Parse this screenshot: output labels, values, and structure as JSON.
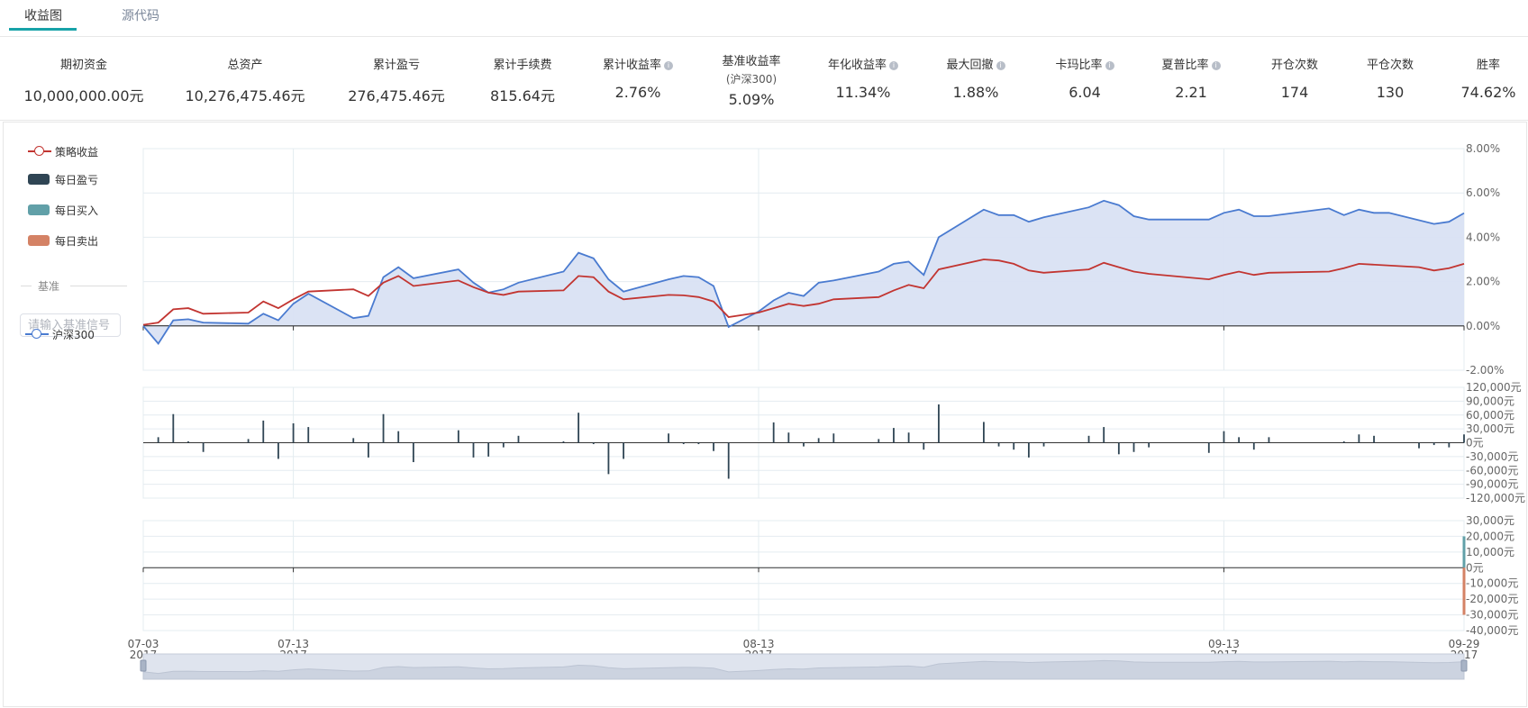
{
  "tabs": [
    {
      "label": "收益图",
      "active": true
    },
    {
      "label": "源代码",
      "active": false
    }
  ],
  "stats": [
    {
      "label": "期初资金",
      "value": "10,000,000.00元"
    },
    {
      "label": "总资产",
      "value": "10,276,475.46元"
    },
    {
      "label": "累计盈亏",
      "value": "276,475.46元"
    },
    {
      "label": "累计手续费",
      "value": "815.64元"
    },
    {
      "label": "累计收益率",
      "value": "2.76%",
      "info": true
    },
    {
      "label": "基准收益率",
      "label2": "(沪深300)",
      "value": "5.09%"
    },
    {
      "label": "年化收益率",
      "value": "11.34%",
      "info": true
    },
    {
      "label": "最大回撤",
      "value": "1.88%",
      "info": true
    },
    {
      "label": "卡玛比率",
      "value": "6.04",
      "info": true
    },
    {
      "label": "夏普比率",
      "value": "2.21",
      "info": true
    },
    {
      "label": "开仓次数",
      "value": "174"
    },
    {
      "label": "平仓次数",
      "value": "130"
    },
    {
      "label": "胜率",
      "value": "74.62%"
    }
  ],
  "legend": {
    "items": [
      {
        "label": "策略收益",
        "kind": "line",
        "color": "#c23531"
      },
      {
        "label": "每日盈亏",
        "kind": "box",
        "color": "#2f4554"
      },
      {
        "label": "每日买入",
        "kind": "box",
        "color": "#61a0a8"
      },
      {
        "label": "每日卖出",
        "kind": "box",
        "color": "#d48265"
      }
    ],
    "benchmark_title": "基准",
    "benchmark_placeholder": "请输入基准信号",
    "benchmark_item": {
      "label": "沪深300",
      "color": "#4a7bd0"
    }
  },
  "chart_data": [
    {
      "type": "line",
      "name": "returns",
      "x_ticks": [
        {
          "idx": 0,
          "date": "07-03",
          "year": "2017"
        },
        {
          "idx": 10,
          "date": "07-13",
          "year": "2017"
        },
        {
          "idx": 41,
          "date": "08-13",
          "year": "2017"
        },
        {
          "idx": 72,
          "date": "09-13",
          "year": "2017"
        },
        {
          "idx": 88,
          "date": "09-29",
          "year": "2017"
        }
      ],
      "x_count": 89,
      "ylim": [
        -2,
        8
      ],
      "y_ticks": [
        "8.00%",
        "6.00%",
        "4.00%",
        "2.00%",
        "0.00%",
        "-2.00%"
      ],
      "series": [
        {
          "name": "策略收益",
          "color": "#c23531",
          "points": [
            [
              0,
              0.05
            ],
            [
              1,
              0.15
            ],
            [
              2,
              0.75
            ],
            [
              3,
              0.8
            ],
            [
              4,
              0.55
            ],
            [
              7,
              0.6
            ],
            [
              8,
              1.1
            ],
            [
              9,
              0.8
            ],
            [
              10,
              1.2
            ],
            [
              11,
              1.55
            ],
            [
              14,
              1.65
            ],
            [
              15,
              1.35
            ],
            [
              16,
              1.95
            ],
            [
              17,
              2.25
            ],
            [
              18,
              1.8
            ],
            [
              21,
              2.05
            ],
            [
              22,
              1.75
            ],
            [
              23,
              1.5
            ],
            [
              24,
              1.4
            ],
            [
              25,
              1.55
            ],
            [
              28,
              1.6
            ],
            [
              29,
              2.25
            ],
            [
              30,
              2.2
            ],
            [
              31,
              1.55
            ],
            [
              32,
              1.2
            ],
            [
              35,
              1.4
            ],
            [
              36,
              1.38
            ],
            [
              37,
              1.3
            ],
            [
              38,
              1.1
            ],
            [
              39,
              0.4
            ],
            [
              41,
              0.6
            ],
            [
              42,
              0.8
            ],
            [
              43,
              1.0
            ],
            [
              44,
              0.9
            ],
            [
              45,
              1.0
            ],
            [
              46,
              1.2
            ],
            [
              49,
              1.3
            ],
            [
              50,
              1.6
            ],
            [
              51,
              1.85
            ],
            [
              52,
              1.7
            ],
            [
              53,
              2.55
            ],
            [
              56,
              3.0
            ],
            [
              57,
              2.95
            ],
            [
              58,
              2.8
            ],
            [
              59,
              2.5
            ],
            [
              60,
              2.4
            ],
            [
              63,
              2.55
            ],
            [
              64,
              2.85
            ],
            [
              65,
              2.65
            ],
            [
              66,
              2.45
            ],
            [
              67,
              2.35
            ],
            [
              71,
              2.1
            ],
            [
              72,
              2.3
            ],
            [
              73,
              2.45
            ],
            [
              74,
              2.3
            ],
            [
              75,
              2.4
            ],
            [
              79,
              2.45
            ],
            [
              80,
              2.6
            ],
            [
              81,
              2.8
            ],
            [
              85,
              2.65
            ],
            [
              86,
              2.5
            ],
            [
              87,
              2.6
            ],
            [
              88,
              2.8
            ]
          ]
        },
        {
          "name": "沪深300",
          "color": "#4a7bd0",
          "points": [
            [
              0,
              0.0
            ],
            [
              1,
              -0.8
            ],
            [
              2,
              0.25
            ],
            [
              3,
              0.3
            ],
            [
              4,
              0.15
            ],
            [
              7,
              0.1
            ],
            [
              8,
              0.55
            ],
            [
              9,
              0.25
            ],
            [
              10,
              1.0
            ],
            [
              11,
              1.45
            ],
            [
              14,
              0.35
            ],
            [
              15,
              0.45
            ],
            [
              16,
              2.2
            ],
            [
              17,
              2.65
            ],
            [
              18,
              2.15
            ],
            [
              21,
              2.55
            ],
            [
              22,
              1.95
            ],
            [
              23,
              1.5
            ],
            [
              24,
              1.65
            ],
            [
              25,
              1.95
            ],
            [
              28,
              2.45
            ],
            [
              29,
              3.3
            ],
            [
              30,
              3.05
            ],
            [
              31,
              2.1
            ],
            [
              32,
              1.55
            ],
            [
              35,
              2.1
            ],
            [
              36,
              2.25
            ],
            [
              37,
              2.2
            ],
            [
              38,
              1.8
            ],
            [
              39,
              -0.05
            ],
            [
              41,
              0.65
            ],
            [
              42,
              1.15
            ],
            [
              43,
              1.5
            ],
            [
              44,
              1.35
            ],
            [
              45,
              1.95
            ],
            [
              46,
              2.05
            ],
            [
              49,
              2.45
            ],
            [
              50,
              2.8
            ],
            [
              51,
              2.9
            ],
            [
              52,
              2.3
            ],
            [
              53,
              4.0
            ],
            [
              56,
              5.25
            ],
            [
              57,
              5.0
            ],
            [
              58,
              5.0
            ],
            [
              59,
              4.7
            ],
            [
              60,
              4.9
            ],
            [
              63,
              5.35
            ],
            [
              64,
              5.65
            ],
            [
              65,
              5.45
            ],
            [
              66,
              4.95
            ],
            [
              67,
              4.8
            ],
            [
              71,
              4.8
            ],
            [
              72,
              5.1
            ],
            [
              73,
              5.25
            ],
            [
              74,
              4.95
            ],
            [
              75,
              4.95
            ],
            [
              79,
              5.3
            ],
            [
              80,
              5.0
            ],
            [
              81,
              5.25
            ],
            [
              82,
              5.1
            ],
            [
              83,
              5.1
            ],
            [
              86,
              4.6
            ],
            [
              87,
              4.7
            ],
            [
              88,
              5.09
            ]
          ]
        }
      ]
    },
    {
      "type": "bar",
      "name": "每日盈亏",
      "color": "#2f4554",
      "ylim": [
        -120000,
        120000
      ],
      "y_ticks": [
        "120,000元",
        "90,000元",
        "60,000元",
        "30,000元",
        "0元",
        "-30,000元",
        "-60,000元",
        "-90,000元",
        "-120,000元"
      ],
      "bars": [
        [
          1,
          12000
        ],
        [
          2,
          62000
        ],
        [
          3,
          3000
        ],
        [
          4,
          -20000
        ],
        [
          7,
          8000
        ],
        [
          8,
          48000
        ],
        [
          9,
          -35000
        ],
        [
          10,
          42000
        ],
        [
          11,
          34000
        ],
        [
          14,
          10000
        ],
        [
          15,
          -32000
        ],
        [
          16,
          62000
        ],
        [
          17,
          25000
        ],
        [
          18,
          -42000
        ],
        [
          21,
          27000
        ],
        [
          22,
          -32000
        ],
        [
          23,
          -30000
        ],
        [
          24,
          -10000
        ],
        [
          25,
          15000
        ],
        [
          28,
          3000
        ],
        [
          29,
          65000
        ],
        [
          30,
          -3000
        ],
        [
          31,
          -68000
        ],
        [
          32,
          -35000
        ],
        [
          35,
          20000
        ],
        [
          36,
          -3000
        ],
        [
          37,
          -3000
        ],
        [
          38,
          -18000
        ],
        [
          39,
          -78000
        ],
        [
          42,
          44000
        ],
        [
          43,
          22000
        ],
        [
          44,
          -8000
        ],
        [
          45,
          10000
        ],
        [
          46,
          20000
        ],
        [
          49,
          8000
        ],
        [
          50,
          32000
        ],
        [
          51,
          22000
        ],
        [
          52,
          -15000
        ],
        [
          53,
          83000
        ],
        [
          56,
          45000
        ],
        [
          57,
          -8000
        ],
        [
          58,
          -15000
        ],
        [
          59,
          -32000
        ],
        [
          60,
          -8000
        ],
        [
          63,
          15000
        ],
        [
          64,
          34000
        ],
        [
          65,
          -25000
        ],
        [
          66,
          -20000
        ],
        [
          67,
          -10000
        ],
        [
          71,
          -22000
        ],
        [
          72,
          25000
        ],
        [
          73,
          12000
        ],
        [
          74,
          -15000
        ],
        [
          75,
          12000
        ],
        [
          80,
          3000
        ],
        [
          81,
          18000
        ],
        [
          82,
          15000
        ],
        [
          85,
          -12000
        ],
        [
          86,
          -5000
        ],
        [
          87,
          -10000
        ],
        [
          88,
          18000
        ]
      ]
    },
    {
      "type": "bar",
      "name": "每日买入/卖出",
      "ylim": [
        -40000,
        30000
      ],
      "y_ticks": [
        "30,000元",
        "20,000元",
        "10,000元",
        "0元",
        "-10,000元",
        "-20,000元",
        "-30,000元",
        "-40,000元"
      ],
      "series": [
        {
          "name": "每日买入",
          "color": "#61a0a8",
          "bars": [
            [
              88,
              20000
            ]
          ]
        },
        {
          "name": "每日卖出",
          "color": "#d48265",
          "bars": [
            [
              88,
              -30000
            ]
          ]
        }
      ]
    }
  ]
}
